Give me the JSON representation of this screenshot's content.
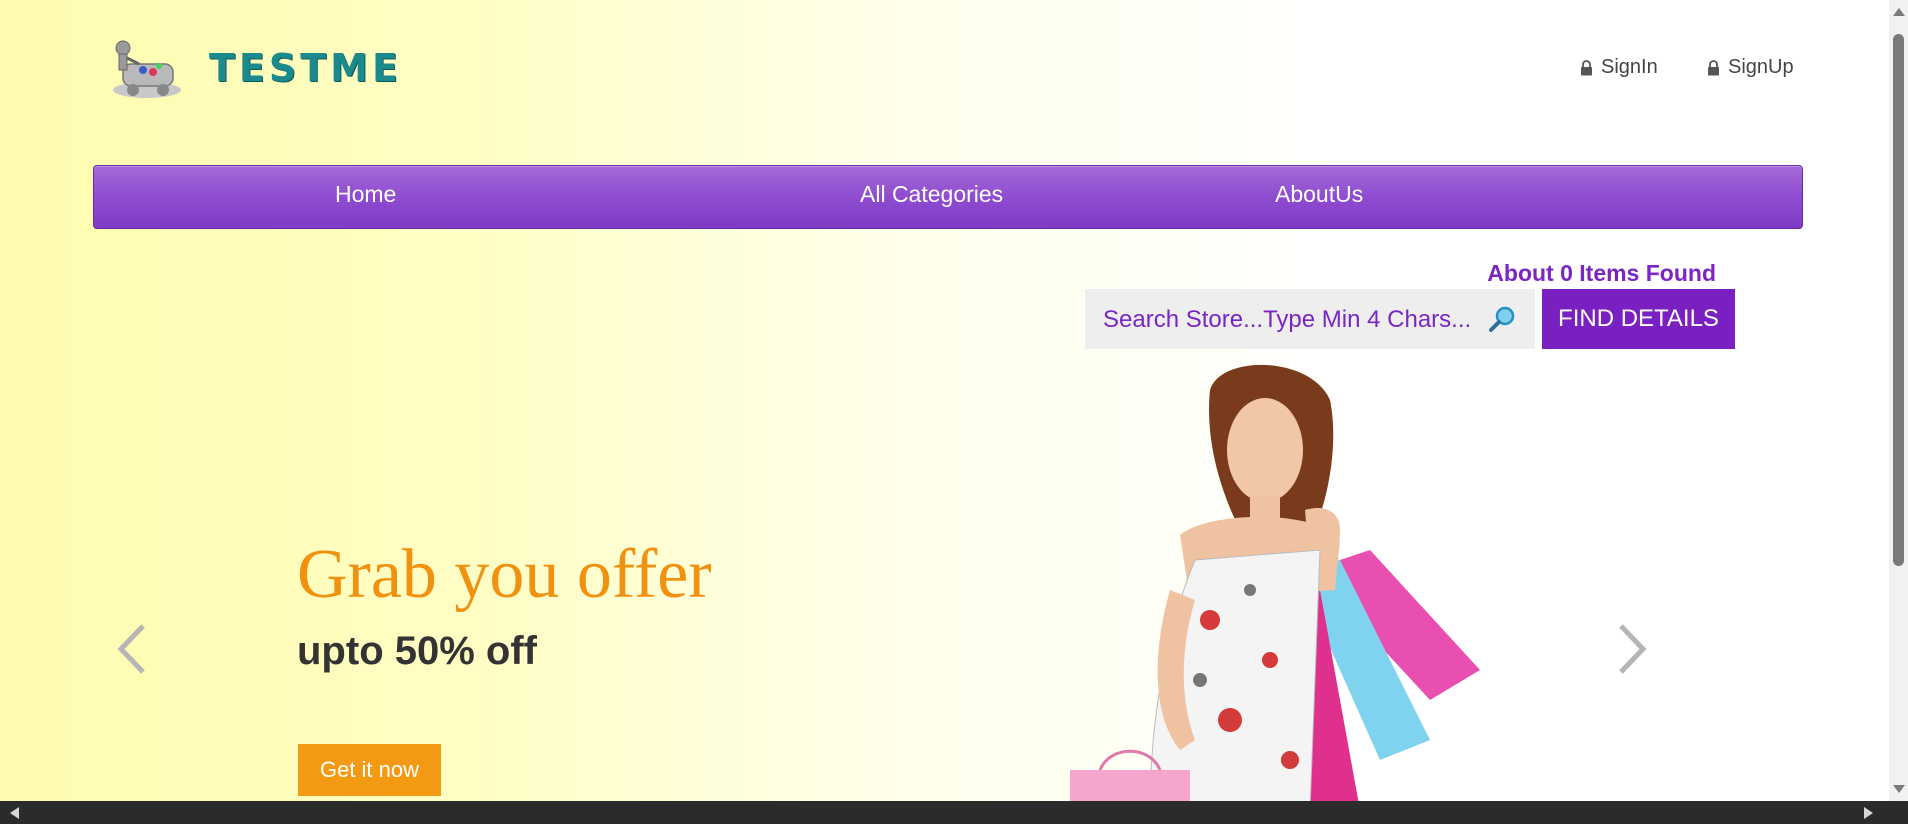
{
  "brand": {
    "name": "TESTME"
  },
  "auth": {
    "signin_label": "SignIn",
    "signup_label": "SignUp"
  },
  "nav": {
    "items": [
      {
        "label": "Home"
      },
      {
        "label": "All Categories"
      },
      {
        "label": "AboutUs"
      }
    ]
  },
  "search": {
    "results_text": "About 0 Items Found",
    "placeholder": "Search Store...Type Min 4 Chars...",
    "button_label": "FIND DETAILS"
  },
  "hero": {
    "headline": "Grab you offer",
    "subline": "upto 50% off",
    "cta_label": "Get it now"
  },
  "icons": {
    "lock": "lock-icon",
    "search": "magnifier-icon",
    "prev": "chevron-left-icon",
    "next": "chevron-right-icon"
  },
  "colors": {
    "nav": "#8f4cd0",
    "accent_purple": "#7a1fc2",
    "headline_orange": "#f0920f",
    "cta_orange": "#f39a12",
    "logo_teal": "#1a8a8c"
  }
}
